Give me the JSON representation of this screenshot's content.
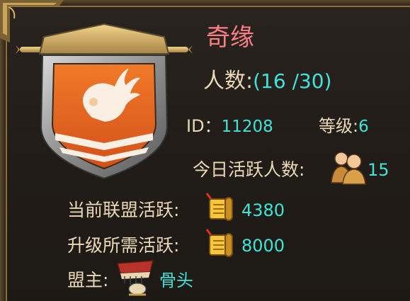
{
  "guild": {
    "name": "奇缘",
    "members_label": "人数:",
    "members_value": "(16 /30)",
    "id_label": "ID：",
    "id_value": "11208",
    "level_label": "等级:",
    "level_value": "6",
    "today_active_label": "今日活跃人数:",
    "today_active_value": "15",
    "current_activity_label": "当前联盟活跃:",
    "current_activity_value": "4380",
    "required_activity_label": "升级所需活跃:",
    "required_activity_value": "8000",
    "leader_label": "盟主:",
    "leader_name": "骨头"
  },
  "icons": {
    "emblem": "fireball-shield-emblem",
    "people": "people-icon",
    "activity": "scroll-icon",
    "leader_avatar": "leader-avatar-icon"
  },
  "colors": {
    "label": "#ead9b6",
    "value": "#3fe3d8",
    "guild_name": "#ff7f86",
    "shield_orange": "#e8641d"
  }
}
